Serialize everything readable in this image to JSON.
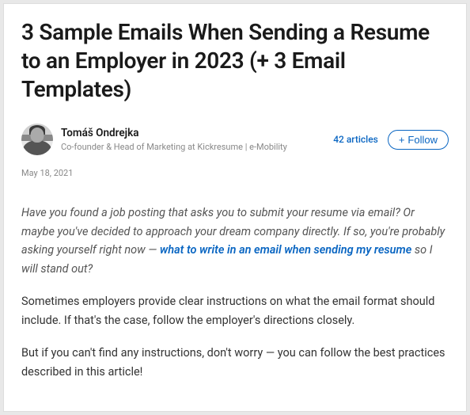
{
  "article": {
    "title": "3 Sample Emails When Sending a Resume to an Employer in 2023 (+ 3 Email Templates)",
    "date": "May 18, 2021"
  },
  "author": {
    "name": "Tomáš Ondrejka",
    "subtitle": "Co-founder & Head of Marketing at Kickresume | e-Mobility",
    "articles_count": "42 articles",
    "follow_label": "Follow"
  },
  "content": {
    "intro_part1": "Have you found a job posting that asks you to submit your resume via email? Or maybe you've decided to approach your dream company directly. If so, you're probably asking yourself right now — ",
    "intro_link": "what to write in an email when sending my resume",
    "intro_part2": " so I will stand out?",
    "para2": "Sometimes employers provide clear instructions on what the email format should include. If that's the case, follow the employer's directions closely.",
    "para3": "But if you can't find any instructions, don't worry — you can follow the best practices described in this article!"
  }
}
